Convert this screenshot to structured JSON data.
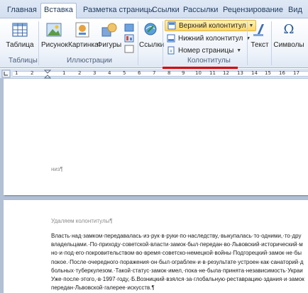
{
  "tabs": [
    {
      "label": "Главная"
    },
    {
      "label": "Вставка"
    },
    {
      "label": "Разметка страницы"
    },
    {
      "label": "Ссылки"
    },
    {
      "label": "Рассылки"
    },
    {
      "label": "Рецензирование"
    },
    {
      "label": "Вид"
    }
  ],
  "ribbon": {
    "tables": {
      "button": "Таблица",
      "group": "Таблицы"
    },
    "illustrations": {
      "buttons": [
        "Рисунок",
        "Картинка",
        "Фигуры"
      ],
      "group": "Иллюстрации"
    },
    "links": {
      "button": "Ссылки"
    },
    "header_footer": {
      "header": "Верхний колонтитул",
      "footer": "Нижний колонтитул",
      "page_number": "Номер страницы",
      "group": "Колонтитулы"
    },
    "text": {
      "button": "Текст"
    },
    "symbols": {
      "button": "Символы"
    }
  },
  "ruler": {
    "numbers": [
      "1",
      "2",
      "1",
      "2",
      "3",
      "4",
      "5",
      "6",
      "7",
      "8",
      "9",
      "10",
      "11",
      "12",
      "13",
      "14",
      "15",
      "16",
      "17"
    ]
  },
  "document": {
    "page1_footer": "низ¶",
    "page2_header": "Удаляем колонтитулы¶",
    "body_lines": [
      "Власть·над·замком·передавалась·из·рук·в·руки·по·наследству,·выкупалась·то·одними,·то·дру",
      "владельцами.·По·приходу·советской·власти·замок·был·передан·во·Львовский·исторический·м",
      "но·и·под·его·покровительством·во·время·советско-немецкой·войны·Подгорецкий·замок·не·бы",
      "покое.·После·очередного·поражения·он·был·ограблен·и·в·результате·устроен·как·санаторий·д",
      "больных·туберкулезом.·Такой·статус·замок·имел,·пока·не·была·принята·независимость·Украи",
      "Уже·после·этого,·в·1997·году,·Б.Возницкий·взялся·за·глобальную·реставрацию·здания·и·замок",
      "передан·Львовской·галерее·искусств.¶"
    ]
  }
}
